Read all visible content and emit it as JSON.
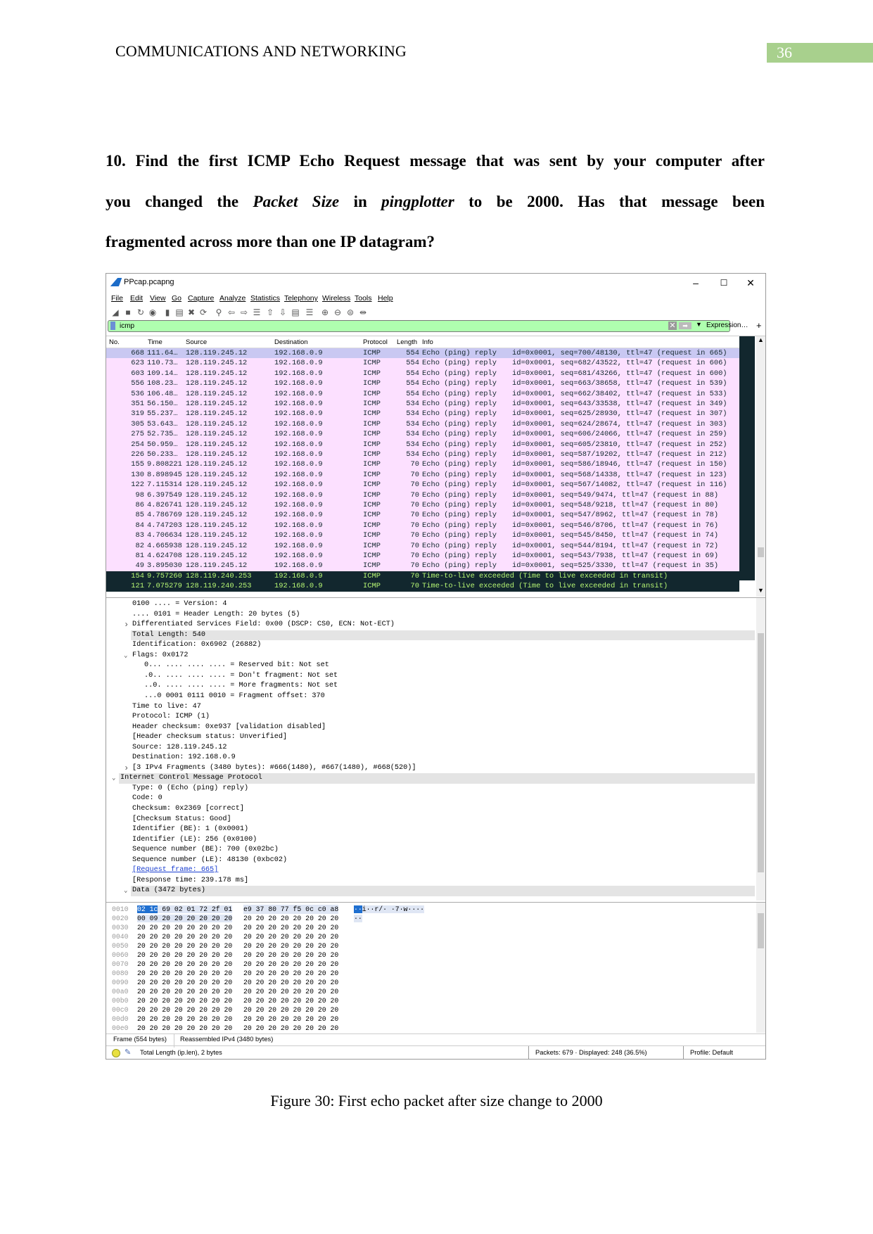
{
  "header": {
    "running_head": "COMMUNICATIONS AND NETWORKING",
    "page_number": "36",
    "accent_color": "#a8d08d"
  },
  "question": {
    "lines": [
      [
        "10. Find the first ICMP Echo Request message that was sent by your computer after"
      ],
      [
        "you changed the ",
        "Packet Size",
        " in ",
        "pingplotter",
        " to be 2000. Has that message been"
      ],
      [
        "fragmented across more than one IP datagram?"
      ]
    ]
  },
  "window": {
    "title": "PPcap.pcapng",
    "controls": {
      "minimize": "–",
      "maximize": "☐",
      "close": "✕"
    },
    "menu": [
      "File",
      "Edit",
      "View",
      "Go",
      "Capture",
      "Analyze",
      "Statistics",
      "Telephony",
      "Wireless",
      "Tools",
      "Help"
    ],
    "toolbar_icons": [
      "shark-fin-start-icon",
      "stop-icon",
      "restart-icon",
      "options-icon",
      "open-folder-icon",
      "save-icon",
      "close-file-icon",
      "reload-icon",
      "find-icon",
      "back-icon",
      "forward-icon",
      "go-to-packet-icon",
      "first-packet-icon",
      "last-packet-icon",
      "autoscroll-icon",
      "colorize-icon",
      "zoom-in-icon",
      "zoom-out-icon",
      "normal-size-icon",
      "resize-columns-icon"
    ],
    "filter": {
      "value": "icmp",
      "expression_label": "Expression…",
      "plus_label": "+",
      "bg_color": "#afffaf"
    }
  },
  "packet_list": {
    "columns": [
      "No.",
      "Time",
      "Source",
      "Destination",
      "Protocol",
      "Length",
      "Info"
    ],
    "colors": {
      "normal_bg": "#fce0ff",
      "selected_bg": "#c9c8f2",
      "ttl_bg": "#12272e",
      "ttl_fg": "#b7f774"
    },
    "rows": [
      {
        "no": "668",
        "time": "111.64…",
        "src": "128.119.245.12",
        "dst": "192.168.0.9",
        "proto": "ICMP",
        "len": "554",
        "info": "Echo (ping) reply",
        "detail": "id=0x0001, seq=700/48130, ttl=47 (request in 665)",
        "type": "selected"
      },
      {
        "no": "623",
        "time": "110.73…",
        "src": "128.119.245.12",
        "dst": "192.168.0.9",
        "proto": "ICMP",
        "len": "554",
        "info": "Echo (ping) reply",
        "detail": "id=0x0001, seq=682/43522, ttl=47 (request in 606)",
        "type": "normal"
      },
      {
        "no": "603",
        "time": "109.14…",
        "src": "128.119.245.12",
        "dst": "192.168.0.9",
        "proto": "ICMP",
        "len": "554",
        "info": "Echo (ping) reply",
        "detail": "id=0x0001, seq=681/43266, ttl=47 (request in 600)",
        "type": "normal"
      },
      {
        "no": "556",
        "time": "108.23…",
        "src": "128.119.245.12",
        "dst": "192.168.0.9",
        "proto": "ICMP",
        "len": "554",
        "info": "Echo (ping) reply",
        "detail": "id=0x0001, seq=663/38658, ttl=47 (request in 539)",
        "type": "normal"
      },
      {
        "no": "536",
        "time": "106.48…",
        "src": "128.119.245.12",
        "dst": "192.168.0.9",
        "proto": "ICMP",
        "len": "554",
        "info": "Echo (ping) reply",
        "detail": "id=0x0001, seq=662/38402, ttl=47 (request in 533)",
        "type": "normal"
      },
      {
        "no": "351",
        "time": "56.150…",
        "src": "128.119.245.12",
        "dst": "192.168.0.9",
        "proto": "ICMP",
        "len": "534",
        "info": "Echo (ping) reply",
        "detail": "id=0x0001, seq=643/33538, ttl=47 (request in 349)",
        "type": "normal"
      },
      {
        "no": "319",
        "time": "55.237…",
        "src": "128.119.245.12",
        "dst": "192.168.0.9",
        "proto": "ICMP",
        "len": "534",
        "info": "Echo (ping) reply",
        "detail": "id=0x0001, seq=625/28930, ttl=47 (request in 307)",
        "type": "normal"
      },
      {
        "no": "305",
        "time": "53.643…",
        "src": "128.119.245.12",
        "dst": "192.168.0.9",
        "proto": "ICMP",
        "len": "534",
        "info": "Echo (ping) reply",
        "detail": "id=0x0001, seq=624/28674, ttl=47 (request in 303)",
        "type": "normal"
      },
      {
        "no": "275",
        "time": "52.735…",
        "src": "128.119.245.12",
        "dst": "192.168.0.9",
        "proto": "ICMP",
        "len": "534",
        "info": "Echo (ping) reply",
        "detail": "id=0x0001, seq=606/24066, ttl=47 (request in 259)",
        "type": "normal"
      },
      {
        "no": "254",
        "time": "50.959…",
        "src": "128.119.245.12",
        "dst": "192.168.0.9",
        "proto": "ICMP",
        "len": "534",
        "info": "Echo (ping) reply",
        "detail": "id=0x0001, seq=605/23810, ttl=47 (request in 252)",
        "type": "normal"
      },
      {
        "no": "226",
        "time": "50.233…",
        "src": "128.119.245.12",
        "dst": "192.168.0.9",
        "proto": "ICMP",
        "len": "534",
        "info": "Echo (ping) reply",
        "detail": "id=0x0001, seq=587/19202, ttl=47 (request in 212)",
        "type": "normal"
      },
      {
        "no": "155",
        "time": "9.808221",
        "src": "128.119.245.12",
        "dst": "192.168.0.9",
        "proto": "ICMP",
        "len": "70",
        "info": "Echo (ping) reply",
        "detail": "id=0x0001, seq=586/18946, ttl=47 (request in 150)",
        "type": "normal"
      },
      {
        "no": "130",
        "time": "8.898945",
        "src": "128.119.245.12",
        "dst": "192.168.0.9",
        "proto": "ICMP",
        "len": "70",
        "info": "Echo (ping) reply",
        "detail": "id=0x0001, seq=568/14338, ttl=47 (request in 123)",
        "type": "normal"
      },
      {
        "no": "122",
        "time": "7.115314",
        "src": "128.119.245.12",
        "dst": "192.168.0.9",
        "proto": "ICMP",
        "len": "70",
        "info": "Echo (ping) reply",
        "detail": "id=0x0001, seq=567/14082, ttl=47 (request in 116)",
        "type": "normal"
      },
      {
        "no": "98",
        "time": "6.397549",
        "src": "128.119.245.12",
        "dst": "192.168.0.9",
        "proto": "ICMP",
        "len": "70",
        "info": "Echo (ping) reply",
        "detail": "id=0x0001, seq=549/9474, ttl=47 (request in 88)",
        "type": "normal"
      },
      {
        "no": "86",
        "time": "4.826741",
        "src": "128.119.245.12",
        "dst": "192.168.0.9",
        "proto": "ICMP",
        "len": "70",
        "info": "Echo (ping) reply",
        "detail": "id=0x0001, seq=548/9218, ttl=47 (request in 80)",
        "type": "normal"
      },
      {
        "no": "85",
        "time": "4.786769",
        "src": "128.119.245.12",
        "dst": "192.168.0.9",
        "proto": "ICMP",
        "len": "70",
        "info": "Echo (ping) reply",
        "detail": "id=0x0001, seq=547/8962, ttl=47 (request in 78)",
        "type": "normal"
      },
      {
        "no": "84",
        "time": "4.747203",
        "src": "128.119.245.12",
        "dst": "192.168.0.9",
        "proto": "ICMP",
        "len": "70",
        "info": "Echo (ping) reply",
        "detail": "id=0x0001, seq=546/8706, ttl=47 (request in 76)",
        "type": "normal"
      },
      {
        "no": "83",
        "time": "4.706634",
        "src": "128.119.245.12",
        "dst": "192.168.0.9",
        "proto": "ICMP",
        "len": "70",
        "info": "Echo (ping) reply",
        "detail": "id=0x0001, seq=545/8450, ttl=47 (request in 74)",
        "type": "normal"
      },
      {
        "no": "82",
        "time": "4.665938",
        "src": "128.119.245.12",
        "dst": "192.168.0.9",
        "proto": "ICMP",
        "len": "70",
        "info": "Echo (ping) reply",
        "detail": "id=0x0001, seq=544/8194, ttl=47 (request in 72)",
        "type": "normal"
      },
      {
        "no": "81",
        "time": "4.624708",
        "src": "128.119.245.12",
        "dst": "192.168.0.9",
        "proto": "ICMP",
        "len": "70",
        "info": "Echo (ping) reply",
        "detail": "id=0x0001, seq=543/7938, ttl=47 (request in 69)",
        "type": "normal"
      },
      {
        "no": "49",
        "time": "3.895030",
        "src": "128.119.245.12",
        "dst": "192.168.0.9",
        "proto": "ICMP",
        "len": "70",
        "info": "Echo (ping) reply",
        "detail": "id=0x0001, seq=525/3330, ttl=47 (request in 35)",
        "type": "normal"
      },
      {
        "no": "154",
        "time": "9.757260",
        "src": "128.119.240.253",
        "dst": "192.168.0.9",
        "proto": "ICMP",
        "len": "70",
        "info": "Time-to-live exceeded (Time to live exceeded in transit)",
        "detail": "",
        "type": "ttl"
      },
      {
        "no": "121",
        "time": "7.075279",
        "src": "128.119.240.253",
        "dst": "192.168.0.9",
        "proto": "ICMP",
        "len": "70",
        "info": "Time-to-live exceeded (Time to live exceeded in transit)",
        "detail": "",
        "type": "ttl"
      }
    ]
  },
  "details": {
    "lines": [
      {
        "text": "0100 .... = Version: 4",
        "level": 2,
        "arrow": ""
      },
      {
        "text": ".... 0101 = Header Length: 20 bytes (5)",
        "level": 2,
        "arrow": ""
      },
      {
        "text": "Differentiated Services Field: 0x00 (DSCP: CS0, ECN: Not-ECT)",
        "level": 2,
        "arrow": "collapsed"
      },
      {
        "text": "Total Length: 540",
        "level": 2,
        "arrow": "",
        "highlight": true
      },
      {
        "text": "Identification: 0x6902 (26882)",
        "level": 2,
        "arrow": ""
      },
      {
        "text": "Flags: 0x0172",
        "level": 2,
        "arrow": "expanded"
      },
      {
        "text": "0... .... .... .... = Reserved bit: Not set",
        "level": 3,
        "arrow": ""
      },
      {
        "text": ".0.. .... .... .... = Don't fragment: Not set",
        "level": 3,
        "arrow": ""
      },
      {
        "text": "..0. .... .... .... = More fragments: Not set",
        "level": 3,
        "arrow": ""
      },
      {
        "text": "...0 0001 0111 0010 = Fragment offset: 370",
        "level": 3,
        "arrow": ""
      },
      {
        "text": "Time to live: 47",
        "level": 2,
        "arrow": ""
      },
      {
        "text": "Protocol: ICMP (1)",
        "level": 2,
        "arrow": ""
      },
      {
        "text": "Header checksum: 0xe937 [validation disabled]",
        "level": 2,
        "arrow": ""
      },
      {
        "text": "[Header checksum status: Unverified]",
        "level": 2,
        "arrow": ""
      },
      {
        "text": "Source: 128.119.245.12",
        "level": 2,
        "arrow": ""
      },
      {
        "text": "Destination: 192.168.0.9",
        "level": 2,
        "arrow": ""
      },
      {
        "text": "[3 IPv4 Fragments (3480 bytes): #666(1480), #667(1480), #668(520)]",
        "level": 2,
        "arrow": "collapsed"
      },
      {
        "text": "Internet Control Message Protocol",
        "level": 1,
        "arrow": "expanded",
        "highlight": true
      },
      {
        "text": "Type: 0 (Echo (ping) reply)",
        "level": 2,
        "arrow": ""
      },
      {
        "text": "Code: 0",
        "level": 2,
        "arrow": ""
      },
      {
        "text": "Checksum: 0x2369 [correct]",
        "level": 2,
        "arrow": ""
      },
      {
        "text": "[Checksum Status: Good]",
        "level": 2,
        "arrow": ""
      },
      {
        "text": "Identifier (BE): 1 (0x0001)",
        "level": 2,
        "arrow": ""
      },
      {
        "text": "Identifier (LE): 256 (0x0100)",
        "level": 2,
        "arrow": ""
      },
      {
        "text": "Sequence number (BE): 700 (0x02bc)",
        "level": 2,
        "arrow": ""
      },
      {
        "text": "Sequence number (LE): 48130 (0xbc02)",
        "level": 2,
        "arrow": ""
      },
      {
        "text": "[Request frame: 665]",
        "level": 2,
        "arrow": "",
        "link": true
      },
      {
        "text": "[Response time: 239.178 ms]",
        "level": 2,
        "arrow": ""
      },
      {
        "text": "Data (3472 bytes)",
        "level": 2,
        "arrow": "expanded",
        "highlight": true
      }
    ]
  },
  "hex": {
    "rows": [
      {
        "offset": "0010",
        "sel": "02 1c",
        "b1": " 69 02 01 72 2f 01",
        "b2": "e9 37 80 77 f5 0c c0 a8",
        "asc_sel": "··",
        "asc": "i··r/· ·7·w····"
      },
      {
        "offset": "0020",
        "sel": "",
        "b1": "00 09 20 20 20 20 20 20",
        "b2": "20 20 20 20 20 20 20 20",
        "asc_sel": "",
        "asc": "··"
      },
      {
        "offset": "0030",
        "sel": "",
        "b1": "20 20 20 20 20 20 20 20",
        "b2": "20 20 20 20 20 20 20 20",
        "asc_sel": "",
        "asc": ""
      },
      {
        "offset": "0040",
        "sel": "",
        "b1": "20 20 20 20 20 20 20 20",
        "b2": "20 20 20 20 20 20 20 20",
        "asc_sel": "",
        "asc": ""
      },
      {
        "offset": "0050",
        "sel": "",
        "b1": "20 20 20 20 20 20 20 20",
        "b2": "20 20 20 20 20 20 20 20",
        "asc_sel": "",
        "asc": ""
      },
      {
        "offset": "0060",
        "sel": "",
        "b1": "20 20 20 20 20 20 20 20",
        "b2": "20 20 20 20 20 20 20 20",
        "asc_sel": "",
        "asc": ""
      },
      {
        "offset": "0070",
        "sel": "",
        "b1": "20 20 20 20 20 20 20 20",
        "b2": "20 20 20 20 20 20 20 20",
        "asc_sel": "",
        "asc": ""
      },
      {
        "offset": "0080",
        "sel": "",
        "b1": "20 20 20 20 20 20 20 20",
        "b2": "20 20 20 20 20 20 20 20",
        "asc_sel": "",
        "asc": ""
      },
      {
        "offset": "0090",
        "sel": "",
        "b1": "20 20 20 20 20 20 20 20",
        "b2": "20 20 20 20 20 20 20 20",
        "asc_sel": "",
        "asc": ""
      },
      {
        "offset": "00a0",
        "sel": "",
        "b1": "20 20 20 20 20 20 20 20",
        "b2": "20 20 20 20 20 20 20 20",
        "asc_sel": "",
        "asc": ""
      },
      {
        "offset": "00b0",
        "sel": "",
        "b1": "20 20 20 20 20 20 20 20",
        "b2": "20 20 20 20 20 20 20 20",
        "asc_sel": "",
        "asc": ""
      },
      {
        "offset": "00c0",
        "sel": "",
        "b1": "20 20 20 20 20 20 20 20",
        "b2": "20 20 20 20 20 20 20 20",
        "asc_sel": "",
        "asc": ""
      },
      {
        "offset": "00d0",
        "sel": "",
        "b1": "20 20 20 20 20 20 20 20",
        "b2": "20 20 20 20 20 20 20 20",
        "asc_sel": "",
        "asc": ""
      },
      {
        "offset": "00e0",
        "sel": "",
        "b1": "20 20 20 20 20 20 20 20",
        "b2": "20 20 20 20 20 20 20 20",
        "asc_sel": "",
        "asc": ""
      }
    ]
  },
  "byte_tabs": [
    "Frame (554 bytes)",
    "Reassembled IPv4 (3480 bytes)"
  ],
  "status": {
    "field": "Total Length (ip.len), 2 bytes",
    "packets": "Packets: 679 · Displayed: 248 (36.5%)",
    "profile": "Profile: Default"
  },
  "caption": "Figure 30: First echo packet after size change to 2000"
}
